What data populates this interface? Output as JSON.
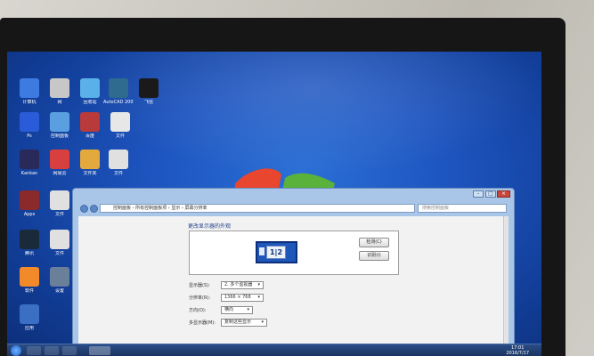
{
  "desktop": {
    "icons": [
      {
        "label": "计算机",
        "icon": "computer-icon",
        "color": "#3d7be0"
      },
      {
        "label": "网",
        "icon": "network-icon",
        "color": "#c7c7c7"
      },
      {
        "label": "回收站",
        "icon": "recycle-bin-icon",
        "color": "#5ab0e8"
      },
      {
        "label": "AutoCAD 2007 - 简体中文",
        "icon": "autocad-icon",
        "color": "#2e6b8e"
      },
      {
        "label": "飞信",
        "icon": "fetion-icon",
        "color": "#1a1a1a"
      },
      {
        "label": "Ps",
        "icon": "photoshop-icon",
        "color": "#2a5bd8"
      },
      {
        "label": "控制面板",
        "icon": "control-panel-icon",
        "color": "#5aa0e0"
      },
      {
        "label": "百度",
        "icon": "baidu-icon",
        "color": "#b83a3a"
      },
      {
        "label": "文件",
        "icon": "file-icon",
        "color": "#e7e7e7"
      },
      {
        "label": "Kankan",
        "icon": "player-icon",
        "color": "#2a2a5a"
      },
      {
        "label": "网易云",
        "icon": "netease-icon",
        "color": "#d84040"
      },
      {
        "label": "文件夹",
        "icon": "folder-icon",
        "color": "#e3a93c"
      },
      {
        "label": "文件",
        "icon": "file-icon",
        "color": "#e0e0e0"
      },
      {
        "label": "Apps",
        "icon": "app-icon",
        "color": "#8a2a2a"
      },
      {
        "label": "文件",
        "icon": "file-icon",
        "color": "#e0e0e0"
      },
      {
        "label": "腾讯",
        "icon": "qq-icon",
        "color": "#1a2a3a"
      },
      {
        "label": "文件",
        "icon": "file-icon",
        "color": "#e0e0e0"
      },
      {
        "label": "软件",
        "icon": "software-icon",
        "color": "#f28a2a"
      },
      {
        "label": "设置",
        "icon": "settings-icon",
        "color": "#6a7f9a"
      },
      {
        "label": "应用",
        "icon": "app-icon",
        "color": "#3a6fc4"
      }
    ]
  },
  "window": {
    "address": "控制面板 › 所有控制面板项 › 显示 › 屏幕分辨率",
    "search_placeholder": "搜索控制面板",
    "heading": "更改显示器的外观",
    "monitor_label": "1|2",
    "detect_button": "检测(C)",
    "identify_button": "识别(I)",
    "rows": [
      {
        "key": "显示器(S):",
        "value": "2. 多个监视器"
      },
      {
        "key": "分辨率(R):",
        "value": "1366 × 768"
      },
      {
        "key": "方向(O):",
        "value": "横向"
      },
      {
        "key": "多显示器(M):",
        "value": "复制这些显示"
      }
    ]
  },
  "taskbar": {
    "time": "17:01",
    "date": "2016/7/17"
  }
}
